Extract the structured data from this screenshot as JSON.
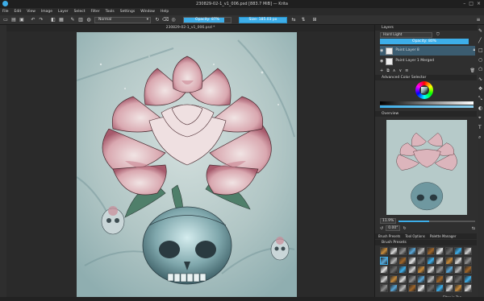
{
  "window": {
    "title": "230829-02-1_v1_006.psd [883.7 MiB] — Krita"
  },
  "menu": [
    "File",
    "Edit",
    "View",
    "Image",
    "Layer",
    "Select",
    "Filter",
    "Tools",
    "Settings",
    "Window",
    "Help"
  ],
  "toolbar": {
    "blend_mode": "Normal",
    "opacity_label": "Opacity: 87%",
    "opacity_value": 87,
    "size_label": "Size: 185.03 px"
  },
  "document_tab": "230829-02-1_v1_006.psd *",
  "layers": {
    "title": "Layers",
    "blend_mode": "Hard Light",
    "opacity_label": "Opacity: 80%",
    "items": [
      {
        "name": "Paint Layer 8",
        "selected": true
      },
      {
        "name": "Paint Layer 1 Merged",
        "selected": false
      }
    ]
  },
  "color_selector": {
    "title": "Advanced Color Selector"
  },
  "overview": {
    "title": "Overview",
    "zoom": "11.9%",
    "rotation": "0.00°"
  },
  "bottom_tabs": [
    "Brush Presets",
    "Tool Options",
    "Palette Manager"
  ],
  "brush_presets": {
    "title": "Brush Presets",
    "filter_label": "Filter in Tag"
  },
  "colors": {
    "accent": "#3daee9",
    "panel": "#2f2f2f",
    "canvas_bg": "#b6cac9"
  }
}
